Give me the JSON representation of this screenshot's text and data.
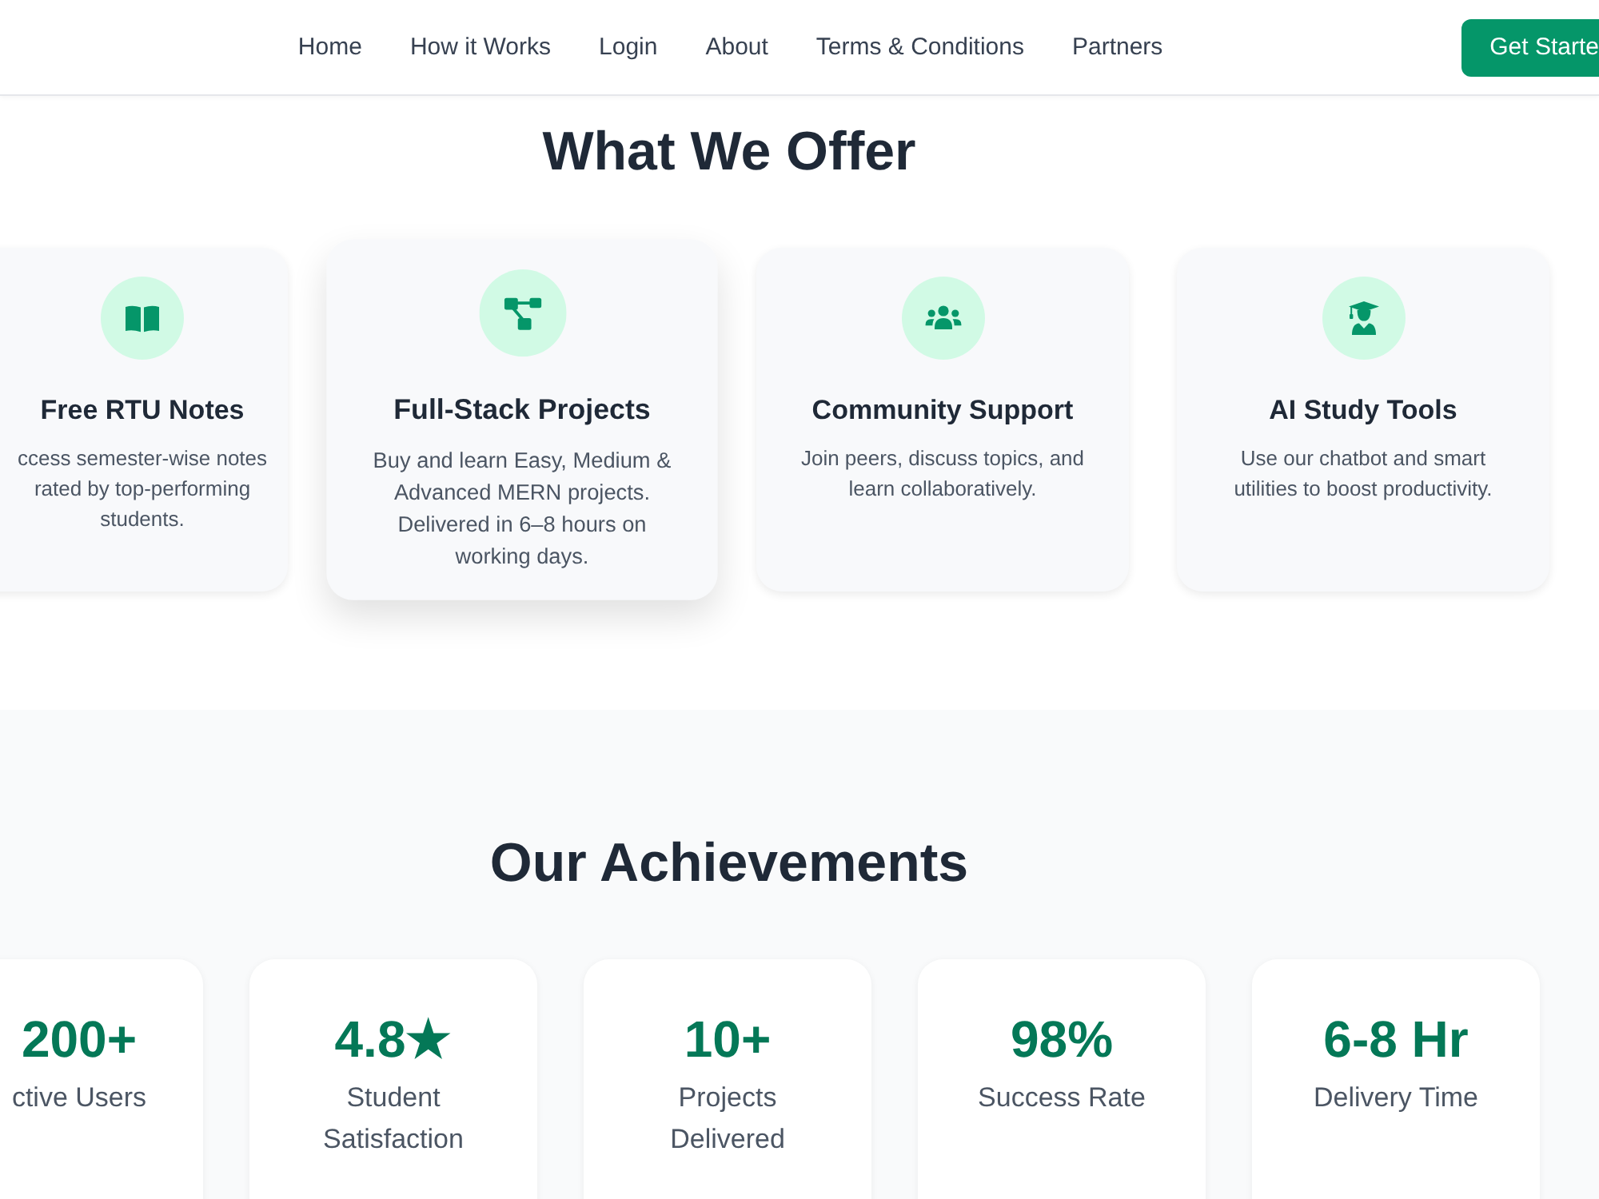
{
  "nav": {
    "links": [
      "Home",
      "How it Works",
      "Login",
      "About",
      "Terms & Conditions",
      "Partners"
    ],
    "cta": "Get Starte"
  },
  "offer": {
    "title": "What We Offer",
    "cards": [
      {
        "title": "Free RTU Notes",
        "description": "ccess semester-wise notes rated by top-performing students.",
        "hovered": false
      },
      {
        "title": "Full-Stack Projects",
        "description": "Buy and learn Easy, Medium & Advanced MERN projects. Delivered in 6–8 hours on working days.",
        "hovered": true
      },
      {
        "title": "Community Support",
        "description": "Join peers, discuss topics, and learn collaboratively.",
        "hovered": false
      },
      {
        "title": "AI Study Tools",
        "description": "Use our chatbot and smart utilities to boost productivity.",
        "hovered": false
      }
    ]
  },
  "achievements": {
    "title": "Our Achievements",
    "stats": [
      {
        "value": "200+",
        "label": "ctive Users"
      },
      {
        "value": "4.8★",
        "label": "Student Satisfaction"
      },
      {
        "value": "10+",
        "label": "Projects Delivered"
      },
      {
        "value": "98%",
        "label": "Success Rate"
      },
      {
        "value": "6-8 Hr",
        "label": "Delivery Time"
      }
    ]
  }
}
